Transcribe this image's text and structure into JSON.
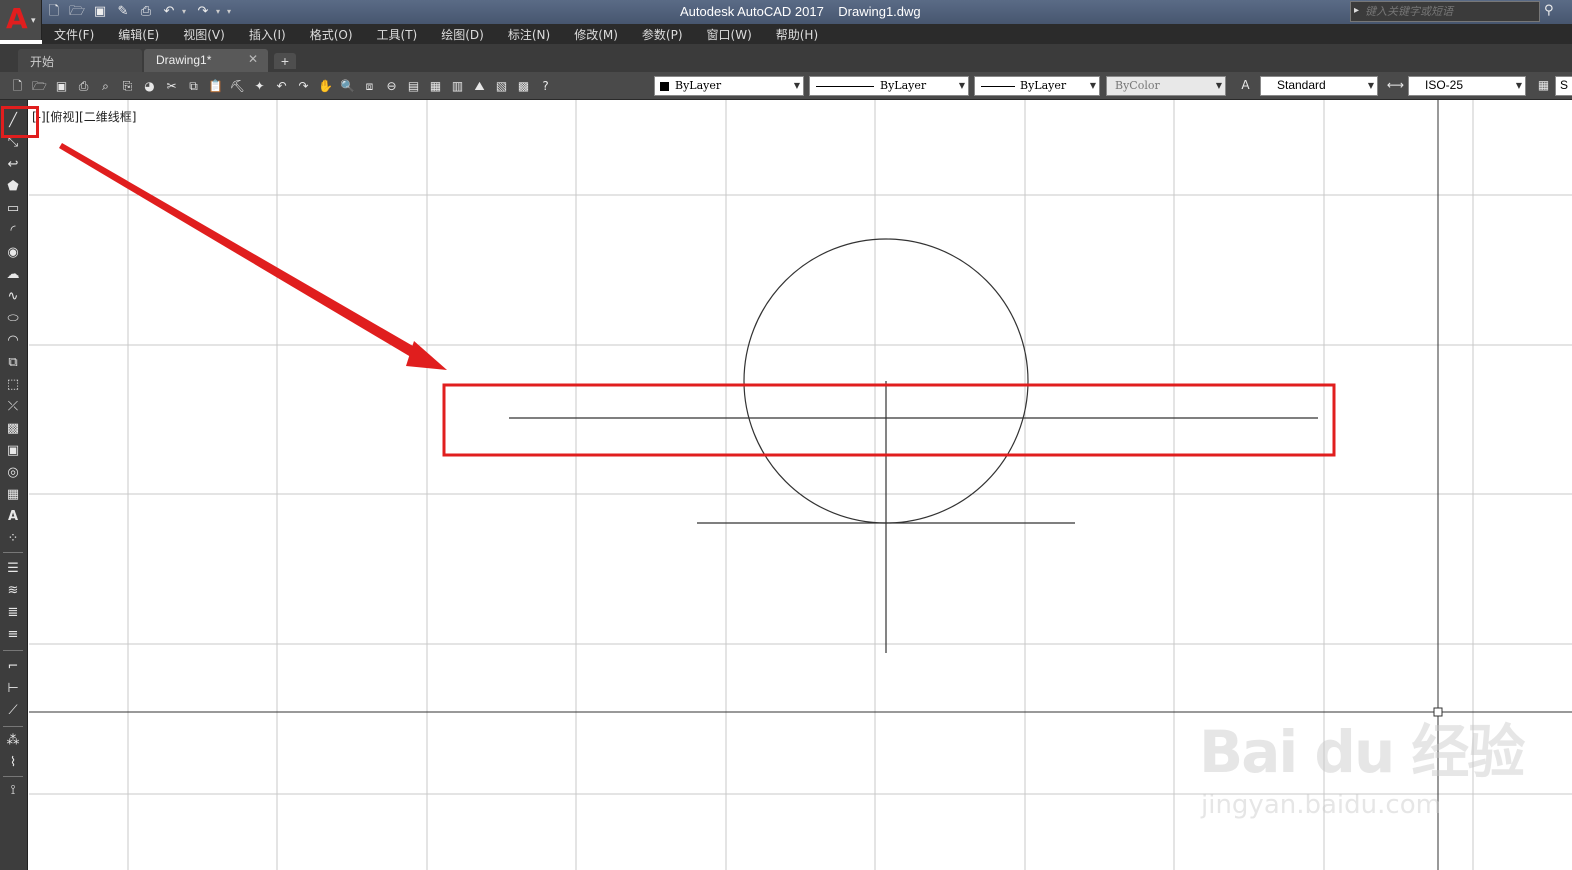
{
  "app": {
    "logo_letter": "A",
    "window_title": "Autodesk AutoCAD 2017    Drawing1.dwg",
    "search_placeholder": "键入关键字或短语"
  },
  "menu": [
    "文件(F)",
    "编辑(E)",
    "视图(V)",
    "插入(I)",
    "格式(O)",
    "工具(T)",
    "绘图(D)",
    "标注(N)",
    "修改(M)",
    "参数(P)",
    "窗口(W)",
    "帮助(H)"
  ],
  "tabs": {
    "start_label": "开始",
    "drawing_label": "Drawing1*",
    "close_glyph": "✕",
    "add_glyph": "+"
  },
  "properties": {
    "color": "ByLayer",
    "linetype": "ByLayer",
    "lineweight": "ByLayer",
    "plotstyle": "ByColor",
    "text_style": "Standard",
    "dim_style": "ISO-25",
    "extra_label": "S"
  },
  "viewport": {
    "label": "[-][俯视][二维线框]"
  },
  "watermark": {
    "brand": "Bai du 经验",
    "url": "jingyan.baidu.com"
  },
  "colors": {
    "highlight": "#e01e1e",
    "grid": "#c8c8c8",
    "geometry": "#333333"
  }
}
